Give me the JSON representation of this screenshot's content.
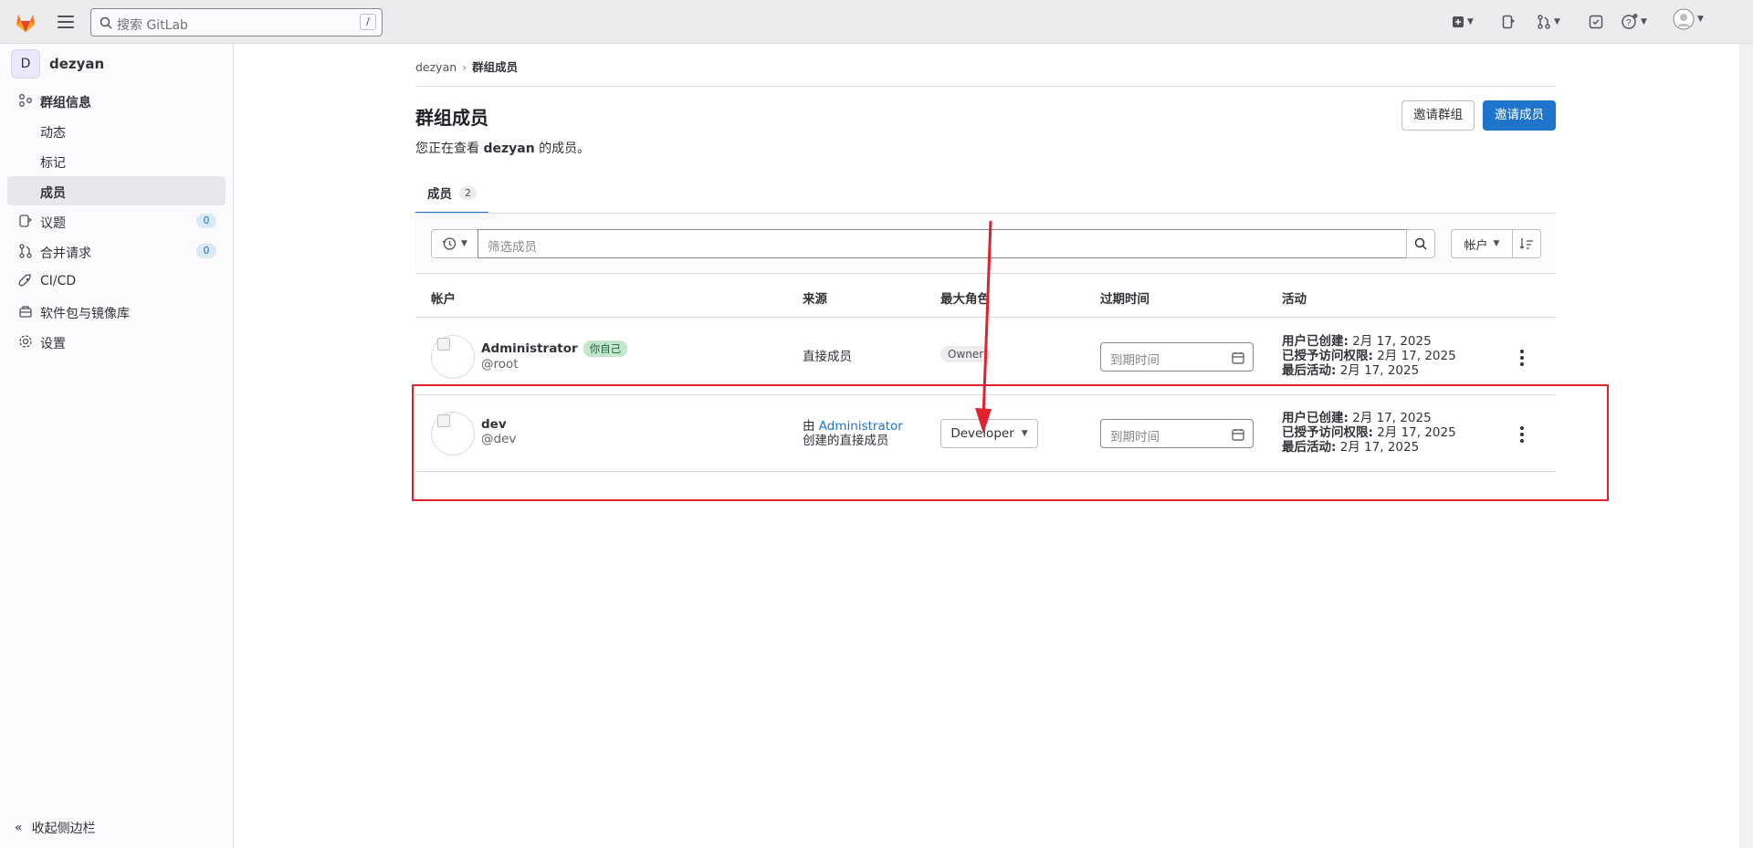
{
  "topbar": {
    "search_placeholder": "搜索 GitLab",
    "search_shortcut": "/"
  },
  "sidebar": {
    "group_initial": "D",
    "group_name": "dezyan",
    "items": [
      {
        "label": "群组信息",
        "icon": "group-info-icon"
      },
      {
        "label": "动态"
      },
      {
        "label": "标记"
      },
      {
        "label": "成员"
      },
      {
        "label": "议题",
        "count": "0",
        "icon": "issues-icon"
      },
      {
        "label": "合并请求",
        "count": "0",
        "icon": "merge-request-icon"
      },
      {
        "label": "CI/CD",
        "icon": "rocket-icon"
      },
      {
        "label": "软件包与镜像库",
        "icon": "package-icon"
      },
      {
        "label": "设置",
        "icon": "gear-icon"
      }
    ],
    "collapse_label": "收起侧边栏"
  },
  "breadcrumb": {
    "root": "dezyan",
    "current": "群组成员"
  },
  "page": {
    "title": "群组成员",
    "desc_prefix": "您正在查看 ",
    "desc_group": "dezyan",
    "desc_suffix": " 的成员。",
    "invite_group_label": "邀请群组",
    "invite_member_label": "邀请成员"
  },
  "tabs": [
    {
      "label": "成员",
      "count": "2"
    }
  ],
  "filter": {
    "placeholder": "筛选成员",
    "sort_label": "帐户"
  },
  "table": {
    "headers": [
      "帐户",
      "来源",
      "最大角色",
      "过期时间",
      "活动"
    ],
    "rows": [
      {
        "name": "Administrator",
        "badge": "你自己",
        "handle": "@root",
        "source": "直接成员",
        "role": "Owner",
        "expires_placeholder": "到期时间",
        "created_label": "用户已创建:",
        "created": "2月 17, 2025",
        "granted_label": "已授予访问权限:",
        "granted": "2月 17, 2025",
        "last_label": "最后活动:",
        "last": "2月 17, 2025"
      },
      {
        "name": "dev",
        "handle": "@dev",
        "source_prefix": "由 ",
        "source_link": "Administrator",
        "source_suffix": "创建的直接成员",
        "role": "Developer",
        "expires_placeholder": "到期时间",
        "created_label": "用户已创建:",
        "created": "2月 17, 2025",
        "granted_label": "已授予访问权限:",
        "granted": "2月 17, 2025",
        "last_label": "最后活动:",
        "last": "2月 17, 2025"
      }
    ]
  },
  "colors": {
    "accent": "#1f75cb",
    "annotation": "#e3202e"
  }
}
